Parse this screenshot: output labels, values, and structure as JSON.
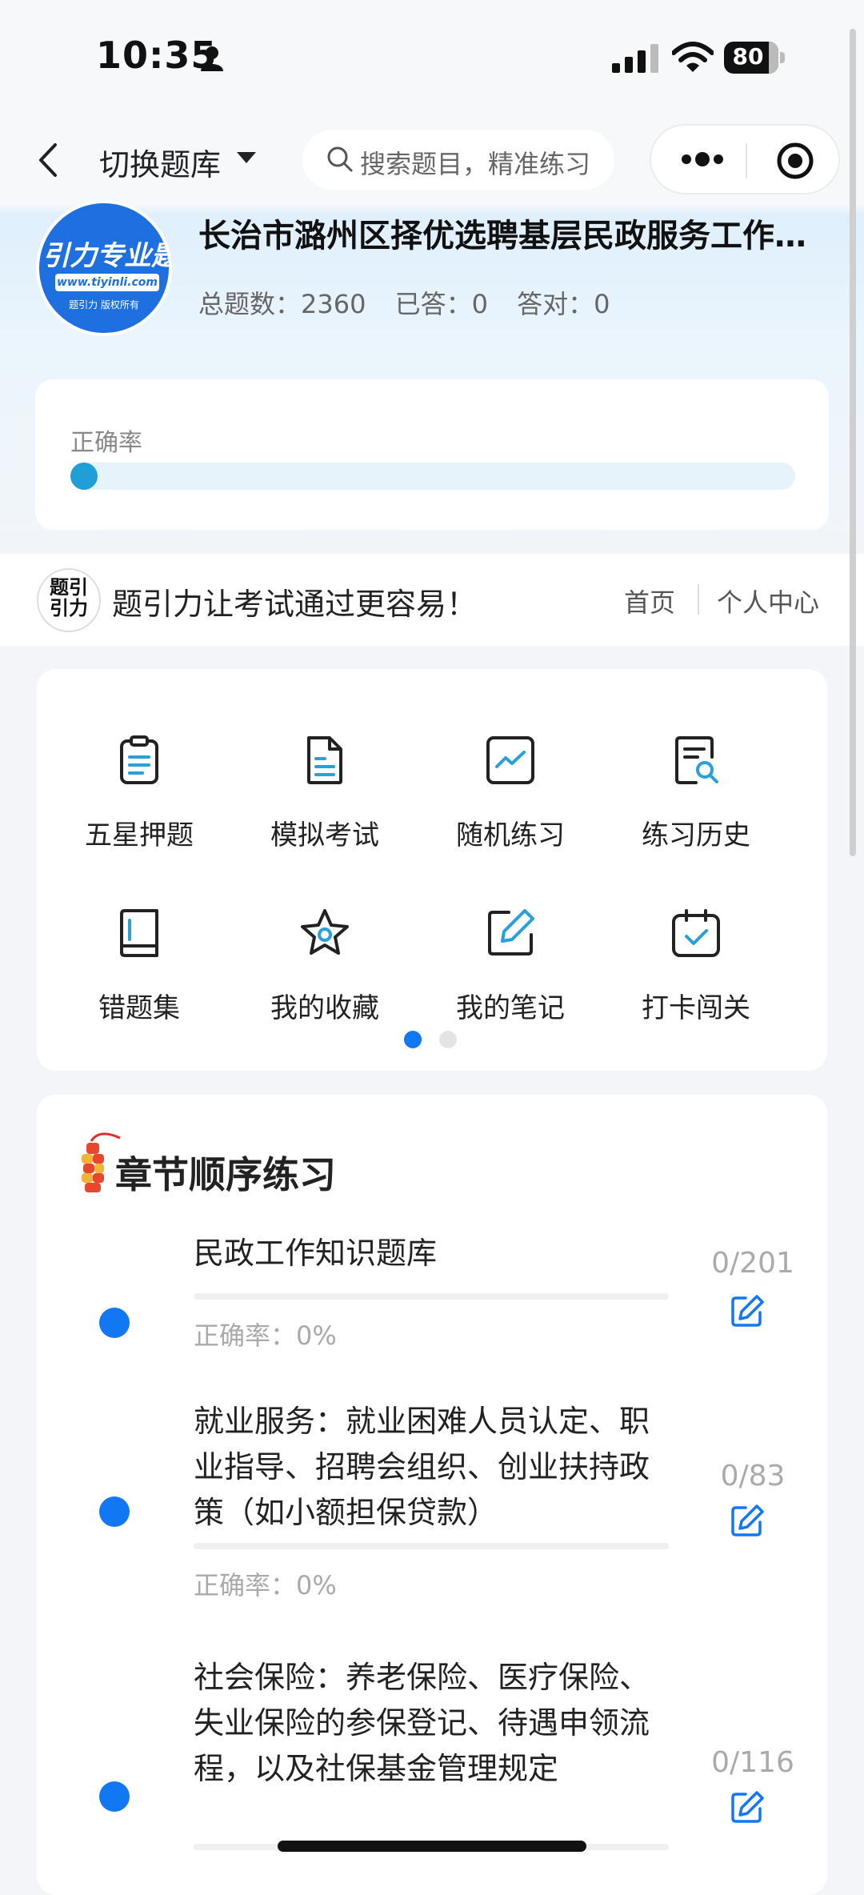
{
  "status_bar": {
    "time": "10:35",
    "battery": "80"
  },
  "nav": {
    "switch_label": "切换题库",
    "search_placeholder": "搜索题目，精准练习"
  },
  "library": {
    "logo_main": "引力专业题",
    "logo_url": "www.tiyinli.com",
    "logo_copyright": "题引力 版权所有",
    "title": "长治市潞州区择优选聘基层民政服务工作者考试题库",
    "stats": {
      "total": "总题数：2360",
      "answered": "已答：0",
      "correct": "答对：0"
    }
  },
  "accuracy": {
    "label": "正确率",
    "fraction": 0.0
  },
  "banner": {
    "logo_line1": "题引",
    "logo_line2": "引力",
    "slogan": "题引力让考试通过更容易！",
    "home_link": "首页",
    "user_link": "个人中心"
  },
  "features": [
    {
      "label": "五星押题",
      "icon": "clipboard-icon"
    },
    {
      "label": "模拟考试",
      "icon": "document-icon"
    },
    {
      "label": "随机练习",
      "icon": "chart-icon"
    },
    {
      "label": "练习历史",
      "icon": "history-search-icon"
    },
    {
      "label": "错题集",
      "icon": "book-icon"
    },
    {
      "label": "我的收藏",
      "icon": "star-icon"
    },
    {
      "label": "我的笔记",
      "icon": "note-edit-icon"
    },
    {
      "label": "打卡闯关",
      "icon": "calendar-check-icon"
    }
  ],
  "pager": {
    "pages": 2,
    "active": 0
  },
  "chapters": {
    "title": "章节顺序练习",
    "items": [
      {
        "name": "民政工作知识题库",
        "rate": "正确率：0%",
        "count": "0/201"
      },
      {
        "name": "就业服务：就业困难人员认定、职业指导、招聘会组织、创业扶持政策（如小额担保贷款）",
        "rate": "正确率：0%",
        "count": "0/83"
      },
      {
        "name": "社会保险：养老保险、医疗保险、失业保险的参保登记、待遇申领流程，以及社保基金管理规定",
        "rate": "",
        "count": "0/116"
      }
    ]
  },
  "colors": {
    "accent": "#1177f2",
    "progress": "#1f9fd6",
    "icon_stroke": "#222",
    "icon_accent": "#2a9fd8"
  }
}
